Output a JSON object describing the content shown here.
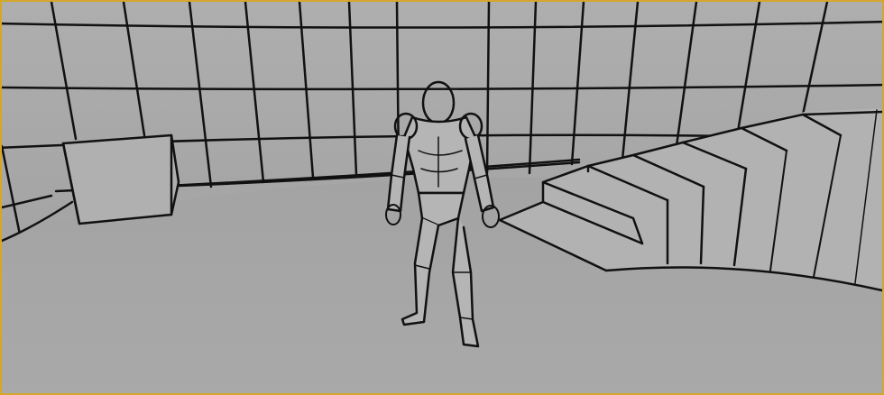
{
  "viewport": {
    "border_color": "#d4a72c",
    "background_color": "#a9a9a9",
    "render_style": "outline",
    "scene_objects": [
      "grid-wall",
      "floor",
      "block",
      "staircase",
      "mannequin-character"
    ]
  }
}
